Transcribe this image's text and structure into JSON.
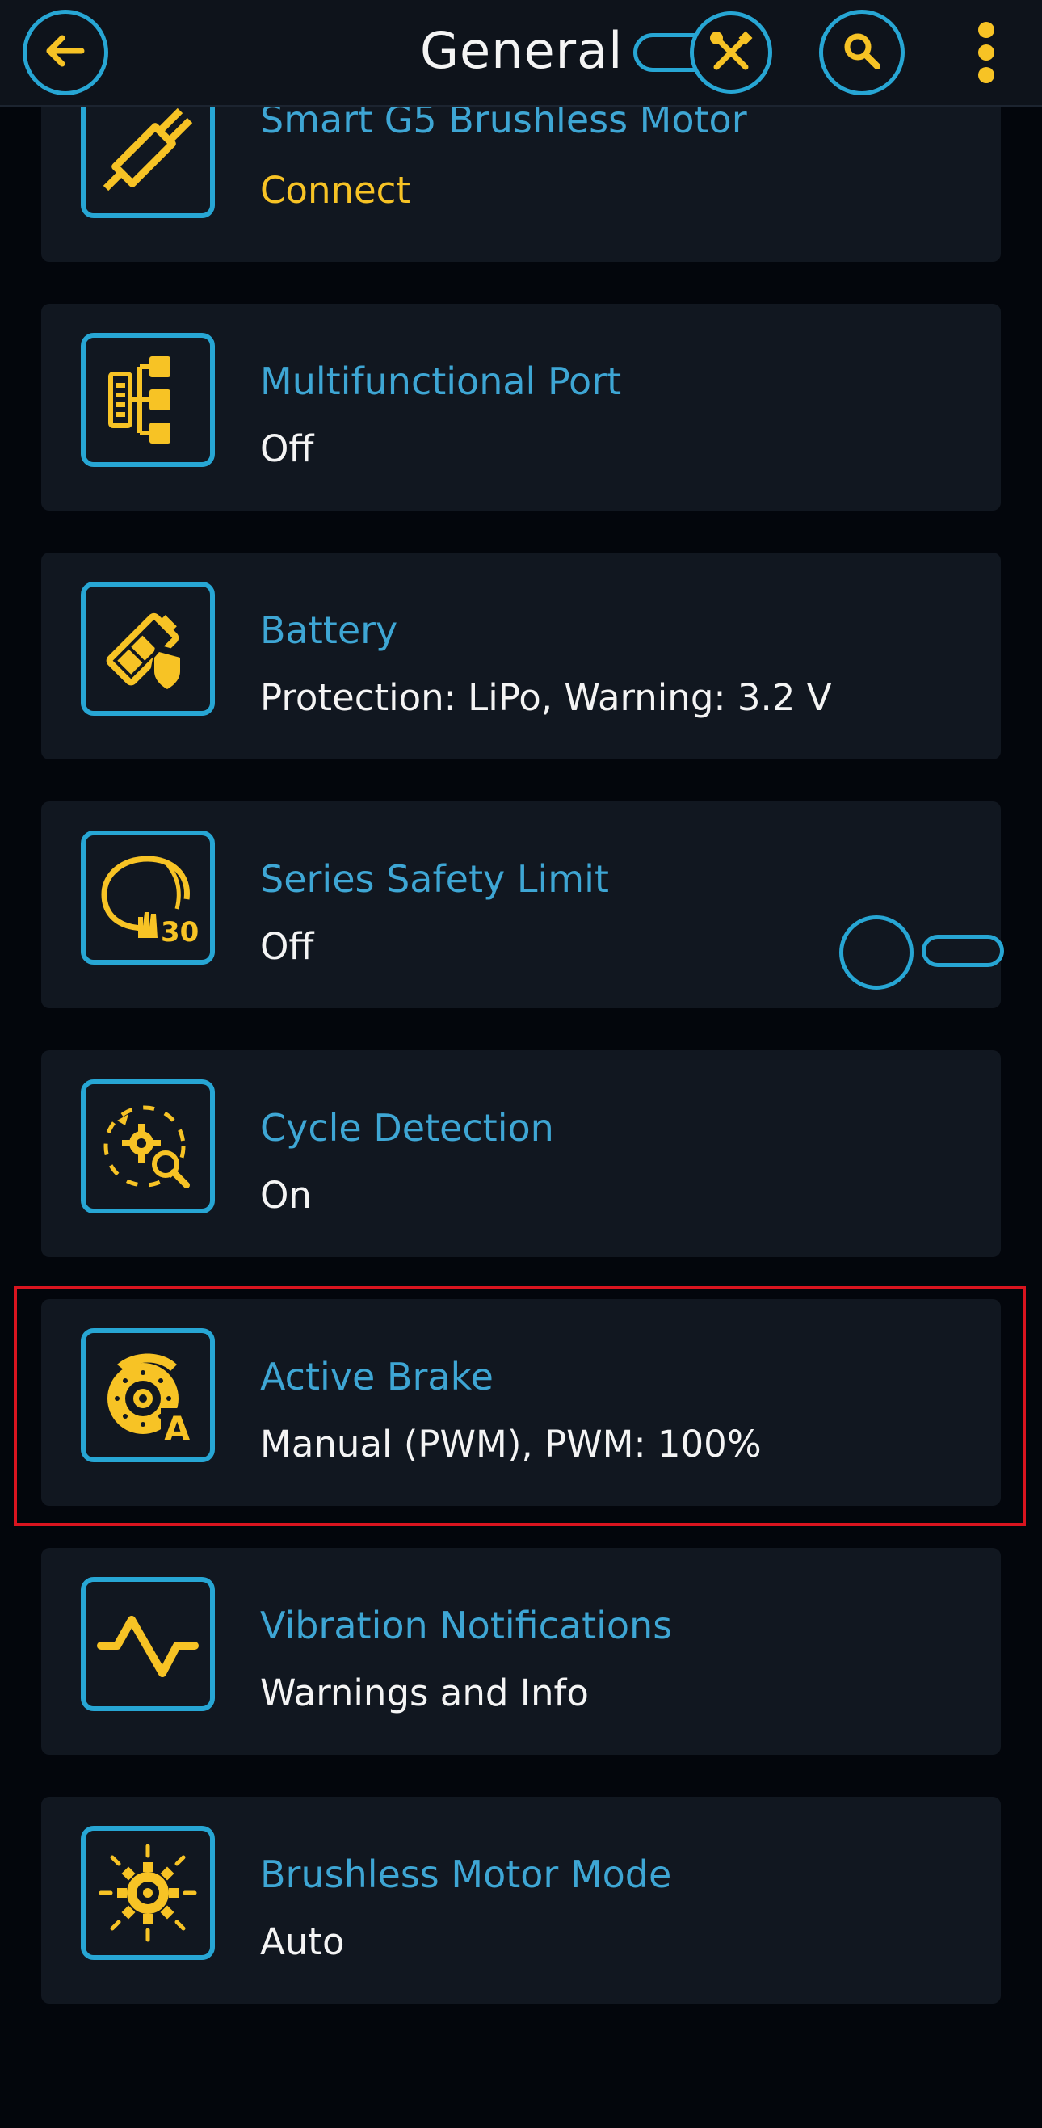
{
  "header": {
    "title": "General",
    "back_icon": "arrow-left-icon",
    "mode_toggle_icon": "wrench-screwdriver-icon",
    "search_icon": "search-icon",
    "menu_icon": "more-vertical-icon"
  },
  "items": [
    {
      "title": "Smart G5 Brushless Motor",
      "value": "Connect",
      "icon": "motor-plug-icon"
    },
    {
      "title": "Multifunctional Port",
      "value": "Off",
      "icon": "port-tree-icon"
    },
    {
      "title": "Battery",
      "value": "Protection: LiPo, Warning: 3.2 V",
      "icon": "battery-shield-icon"
    },
    {
      "title": "Series Safety Limit",
      "value": "Off",
      "icon": "safety-limit-icon",
      "icon_text": "30",
      "switch_on": false
    },
    {
      "title": "Cycle Detection",
      "value": "On",
      "icon": "cycle-gear-icon"
    },
    {
      "title": "Active Brake",
      "value": "Manual (PWM), PWM: 100%",
      "icon": "brake-disc-icon",
      "icon_text": "A",
      "highlighted": true
    },
    {
      "title": "Vibration Notifications",
      "value": "Warnings and Info",
      "icon": "vibration-wave-icon"
    },
    {
      "title": "Brushless Motor Mode",
      "value": "Auto",
      "icon": "gear-mode-icon"
    }
  ],
  "colors": {
    "background": "#03060c",
    "card": "#111720",
    "accent_blue": "#27a6d4",
    "title_blue": "#3ea6d4",
    "accent_yellow": "#f7c325",
    "text": "#f4f4f4",
    "highlight_red": "#d9141f"
  }
}
